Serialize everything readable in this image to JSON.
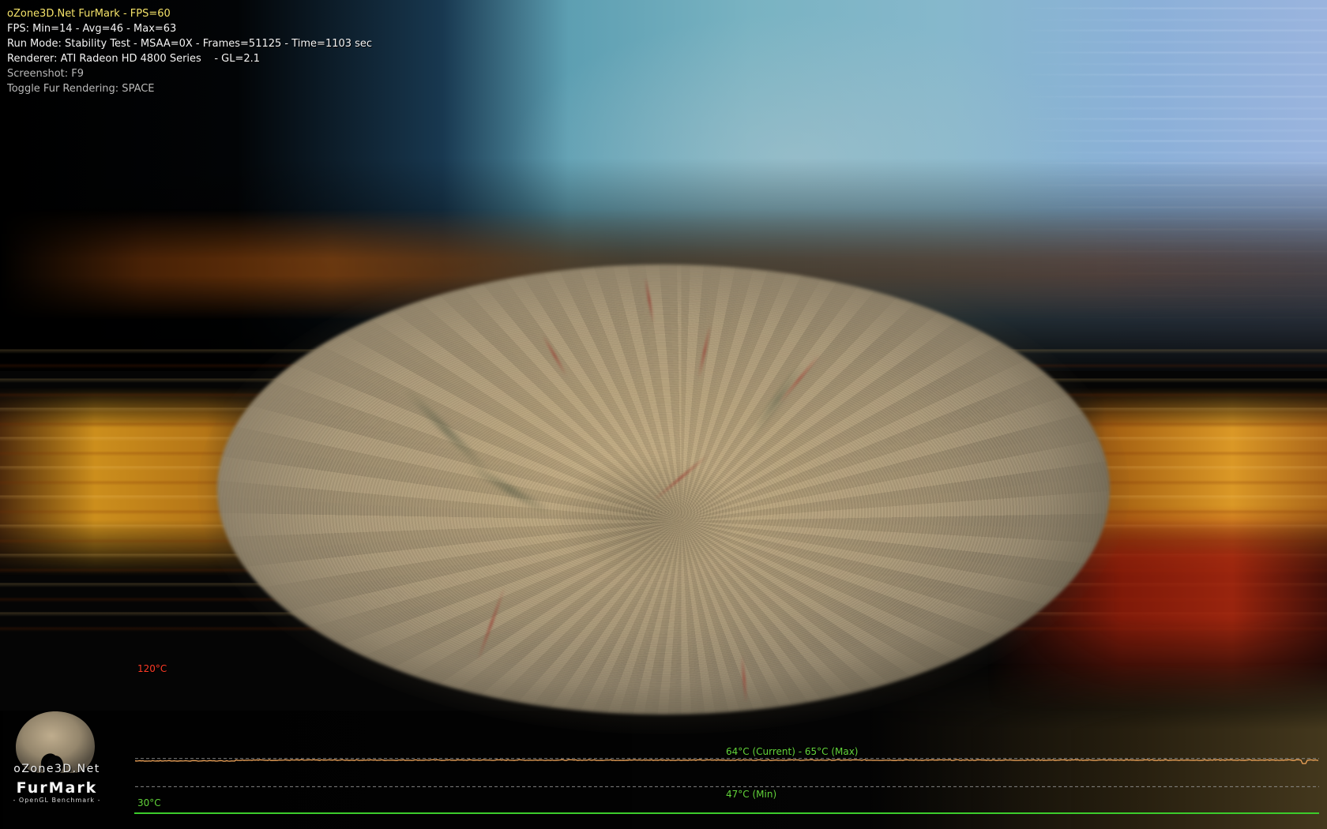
{
  "hud": {
    "title": "oZone3D.Net FurMark - FPS=60",
    "fps_stats": "FPS: Min=14 - Avg=46 - Max=63",
    "run_mode": "Run Mode: Stability Test - MSAA=0X - Frames=51125 - Time=1103 sec",
    "renderer": "Renderer: ATI Radeon HD 4800 Series    - GL=2.1",
    "screenshot_hint": "Screenshot: F9",
    "toggle_hint": "Toggle Fur Rendering: SPACE"
  },
  "temperature_graph": {
    "max_scale_label": "120°C",
    "min_scale_label": "30°C",
    "current_max_label": "64°C (Current) - 65°C (Max)",
    "min_label": "47°C (Min)",
    "scale_min_c": 30,
    "scale_max_c": 120,
    "current_c": 64,
    "max_c": 65,
    "min_c": 47,
    "colors": {
      "axis_top": "#e0301e",
      "axis_bottom": "#3ccc2c",
      "trace": "#f0a55a",
      "reference_lines": "#9a9a9a",
      "label_green": "#62d33a",
      "label_red": "#ff3b26"
    }
  },
  "logo": {
    "site": "oZone3D.Net",
    "name": "FurMark",
    "subtitle": "- OpenGL Benchmark -",
    "icon": "fur-torus-icon"
  },
  "scene": {
    "icon": "fur-donut",
    "colors": {
      "fur": "#b8a27c",
      "sky": "#79b3c2",
      "streak_orange": "#d7962a",
      "streak_red": "#a3281a"
    }
  }
}
